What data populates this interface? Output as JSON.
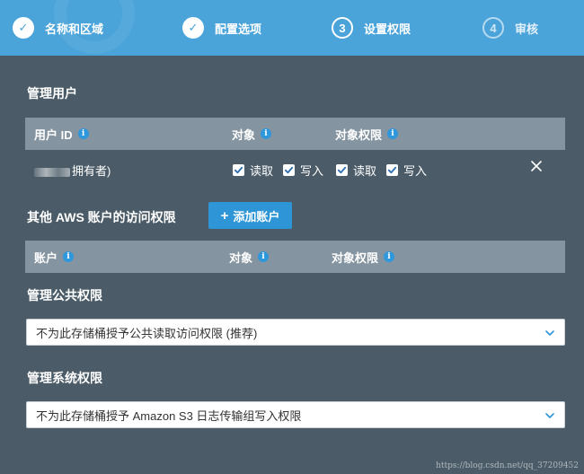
{
  "stepper": {
    "steps": [
      {
        "number": "✓",
        "label": "名称和区域",
        "state": "done"
      },
      {
        "number": "✓",
        "label": "配置选项",
        "state": "done"
      },
      {
        "number": "3",
        "label": "设置权限",
        "state": "active"
      },
      {
        "number": "4",
        "label": "审核",
        "state": "pending"
      }
    ]
  },
  "manage_users": {
    "title": "管理用户",
    "headers": {
      "user_id": "用户 ID",
      "object": "对象",
      "object_permissions": "对象权限"
    },
    "owner_row": {
      "name_suffix": "拥有者)",
      "object_read": "读取",
      "object_write": "写入",
      "perm_read": "读取",
      "perm_write": "写入"
    }
  },
  "other_accounts": {
    "title": "其他 AWS 账户的访问权限",
    "add_button": "添加账户",
    "headers": {
      "account": "账户",
      "object": "对象",
      "object_permissions": "对象权限"
    }
  },
  "public_permissions": {
    "title": "管理公共权限",
    "selected": "不为此存储桶授予公共读取访问权限 (推荐)"
  },
  "system_permissions": {
    "title": "管理系统权限",
    "selected": "不为此存储桶授予 Amazon S3 日志传输组写入权限"
  },
  "watermark": "https://blog.csdn.net/qq_37209452",
  "colors": {
    "header_blue": "#4aa3d9",
    "panel": "#4b5c68",
    "table_head": "#8494a0",
    "button_blue": "#2e95d6",
    "info_blue": "#2f97dc"
  },
  "icons": {
    "info": "info-icon",
    "check": "checkmark-icon",
    "remove": "close-icon",
    "dropdown": "chevron-down-icon",
    "add": "plus-icon"
  }
}
